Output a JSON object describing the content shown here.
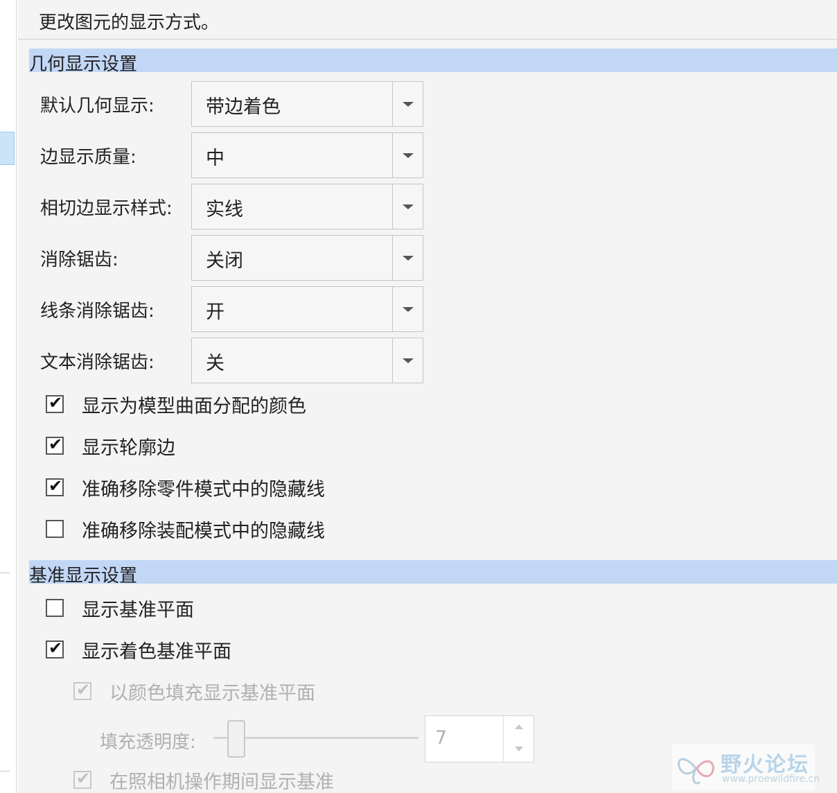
{
  "description": "更改图元的显示方式。",
  "geometry_section": {
    "title": "几何显示设置",
    "fields": [
      {
        "label": "默认几何显示:",
        "value": "带边着色"
      },
      {
        "label": "边显示质量:",
        "value": "中"
      },
      {
        "label": "相切边显示样式:",
        "value": "实线"
      },
      {
        "label": "消除锯齿:",
        "value": "关闭"
      },
      {
        "label": "线条消除锯齿:",
        "value": "开"
      },
      {
        "label": "文本消除锯齿:",
        "value": "关"
      }
    ],
    "checkboxes": [
      {
        "label": "显示为模型曲面分配的颜色",
        "checked": true
      },
      {
        "label": "显示轮廓边",
        "checked": true
      },
      {
        "label": "准确移除零件模式中的隐藏线",
        "checked": true
      },
      {
        "label": "准确移除装配模式中的隐藏线",
        "checked": false
      }
    ]
  },
  "datum_section": {
    "title": "基准显示设置",
    "checkboxes": [
      {
        "label": "显示基准平面",
        "checked": false,
        "enabled": true
      },
      {
        "label": "显示着色基准平面",
        "checked": true,
        "enabled": true
      },
      {
        "label": "以颜色填充显示基准平面",
        "checked": true,
        "enabled": false
      }
    ],
    "fill_transparency": {
      "label": "填充透明度:",
      "value": "7",
      "level": 0.07
    },
    "last_checkbox": {
      "label": "在照相机操作期间显示基准",
      "checked": true,
      "enabled": false
    }
  },
  "watermark": {
    "title": "野火论坛",
    "url": "www.proewildfire.cn"
  },
  "check_glyph": "✔",
  "colors": {
    "section_header": "#c2d7f6",
    "panel_bg": "#f4f4f4",
    "disabled_text": "#b0b0b0"
  }
}
